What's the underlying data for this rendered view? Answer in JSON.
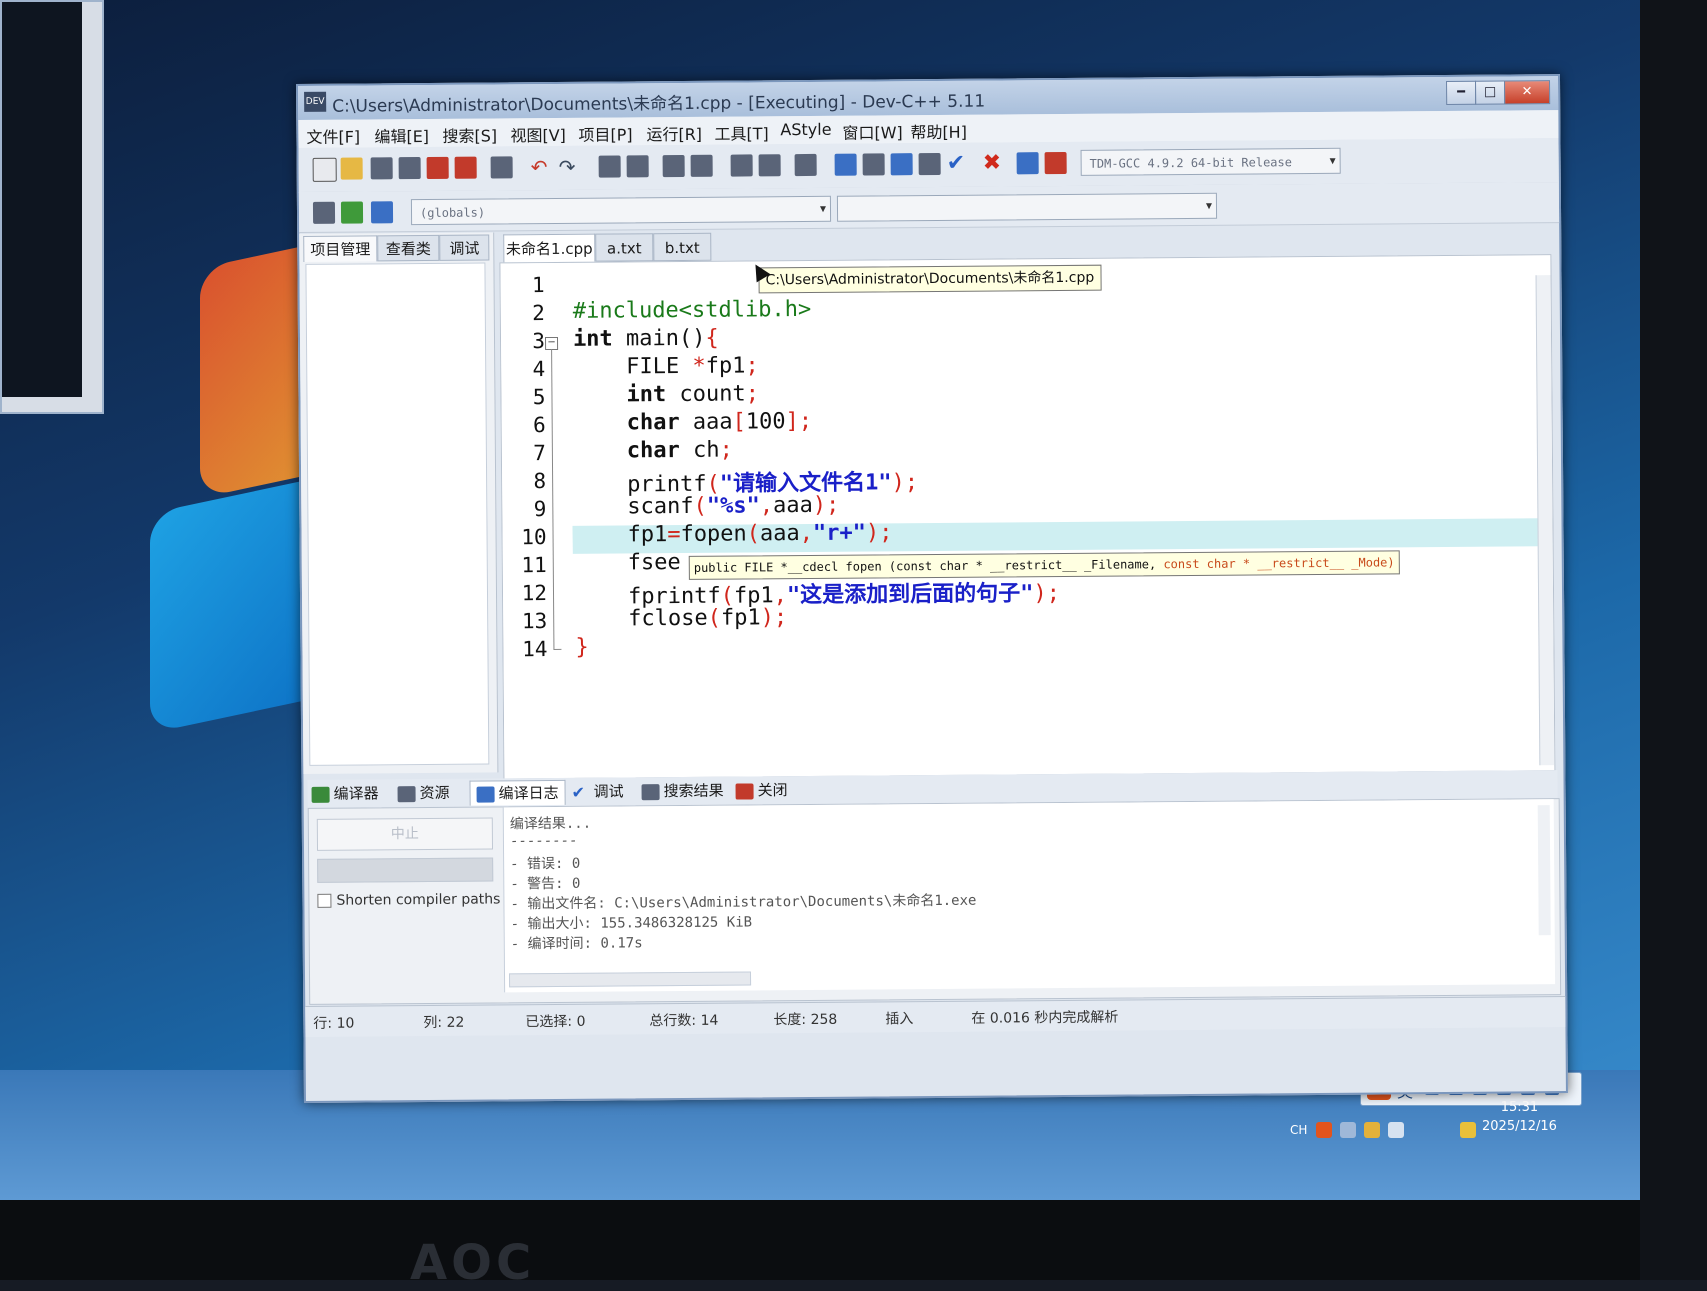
{
  "window": {
    "title": "C:\\Users\\Administrator\\Documents\\未命名1.cpp - [Executing] - Dev-C++ 5.11",
    "buttons": {
      "minimize": "━",
      "maximize": "□",
      "close": "✕"
    }
  },
  "menu": [
    "文件[F]",
    "编辑[E]",
    "搜索[S]",
    "视图[V]",
    "项目[P]",
    "运行[R]",
    "工具[T]",
    "AStyle",
    "窗口[W]",
    "帮助[H]"
  ],
  "toolbar": {
    "scope_combo": "(globals)",
    "compiler_combo": "TDM-GCC 4.9.2 64-bit Release"
  },
  "left_panel": {
    "tabs": [
      "项目管理",
      "查看类",
      "调试"
    ]
  },
  "editor": {
    "tabs": [
      "未命名1.cpp",
      "a.txt",
      "b.txt"
    ],
    "tooltip_path": "C:\\Users\\Administrator\\Documents\\未命名1.cpp",
    "tooltip_signature_1": "public FILE *__cdecl fopen (const char * __restrict__ _Filename, ",
    "tooltip_signature_2": "const char * __restrict__ _Mode)",
    "line_numbers": [
      "1",
      "2",
      "3",
      "4",
      "5",
      "6",
      "7",
      "8",
      "9",
      "10",
      "11",
      "12",
      "13",
      "14"
    ],
    "lines": {
      "l2": "#include<stdlib.h>",
      "l3_kw": "int",
      "l3_rest": " main()",
      "l3_brace": "{",
      "l4_a": "    FILE ",
      "l4_star": "*",
      "l4_b": "fp1",
      "l4_semi": ";",
      "l5_kw": "    int",
      "l5_b": " count",
      "l5_semi": ";",
      "l6_kw": "    char",
      "l6_b": " aaa",
      "l6_br1": "[",
      "l6_num": "100",
      "l6_br2": "];",
      "l7_kw": "    char",
      "l7_b": " ch",
      "l7_semi": ";",
      "l8_a": "    printf",
      "l8_p1": "(",
      "l8_str": "\"请输入文件名1\"",
      "l8_p2": ");",
      "l9_a": "    scanf",
      "l9_p1": "(",
      "l9_str": "\"%s\"",
      "l9_comma": ",",
      "l9_b": "aaa",
      "l9_p2": ");",
      "l10_a": "    fp1",
      "l10_eq": "=",
      "l10_b": "fopen",
      "l10_p1": "(",
      "l10_c": "aaa",
      "l10_comma": ",",
      "l10_str": "\"r+\"",
      "l10_p2": ");",
      "l11_a": "    fsee",
      "l12_a": "    fprintf",
      "l12_p1": "(",
      "l12_b": "fp1",
      "l12_comma": ",",
      "l12_str": "\"这是添加到后面的句子\"",
      "l12_p2": ");",
      "l13_a": "    fclose",
      "l13_p1": "(",
      "l13_b": "fp1",
      "l13_p2": ");",
      "l14": "}"
    }
  },
  "bottom_panel": {
    "tabs": [
      "编译器",
      "资源",
      "编译日志",
      "调试",
      "搜索结果",
      "关闭"
    ],
    "abort_button": "中止",
    "shorten_paths": "Shorten compiler paths",
    "log": [
      "编译结果...",
      "--------",
      "- 错误: 0",
      "- 警告: 0",
      "- 输出文件名: C:\\Users\\Administrator\\Documents\\未命名1.exe",
      "- 输出大小: 155.3486328125 KiB",
      "- 编译时间: 0.17s"
    ]
  },
  "statusbar": {
    "row_label": "行:",
    "row": "10",
    "col_label": "列:",
    "col": "22",
    "sel_label": "已选择:",
    "sel": "0",
    "lines_label": "总行数:",
    "lines": "14",
    "len_label": "长度:",
    "len": "258",
    "mode": "插入",
    "parse": "在 0.016 秒内完成解析"
  },
  "taskbar": {
    "ime_lang": "英",
    "tray_lang": "CH",
    "time": "15:31",
    "date": "2025/12/16"
  },
  "monitor": {
    "brand": "AOC"
  }
}
